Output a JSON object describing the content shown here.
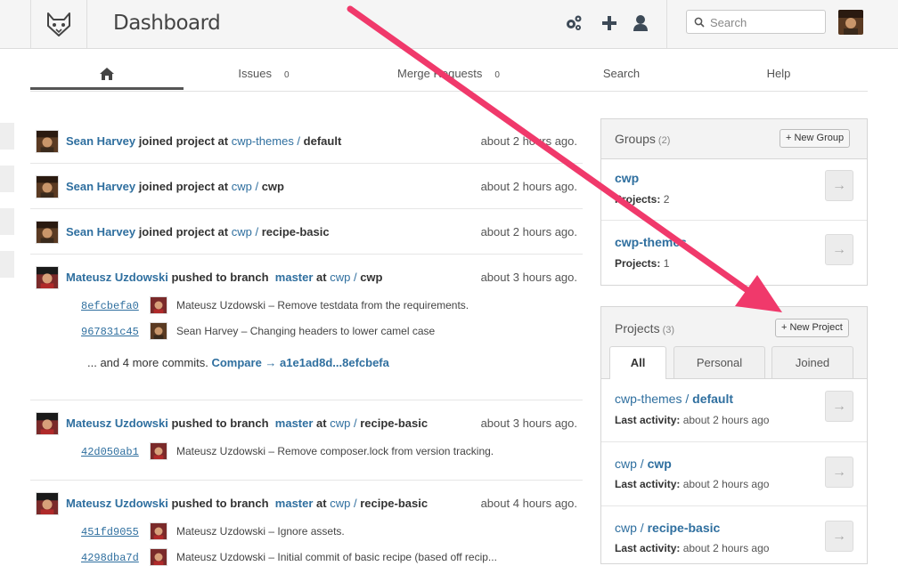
{
  "header": {
    "title": "Dashboard",
    "search_placeholder": "Search",
    "icons": [
      "gitlab-fox-logo",
      "settings-gears-icon",
      "plus-icon",
      "user-icon",
      "search-icon"
    ]
  },
  "nav": {
    "home_icon": "home-icon",
    "issues_label": "Issues",
    "issues_count": "0",
    "mr_label": "Merge Requests",
    "mr_count": "0",
    "search_label": "Search",
    "help_label": "Help"
  },
  "events": [
    {
      "author": "Sean Harvey",
      "action": "joined project",
      "at": "at",
      "namespace": "cwp-themes /",
      "project": "default",
      "time": "about 2 hours ago."
    },
    {
      "author": "Sean Harvey",
      "action": "joined project",
      "at": "at",
      "namespace": "cwp /",
      "project": "cwp",
      "time": "about 2 hours ago."
    },
    {
      "author": "Sean Harvey",
      "action": "joined project",
      "at": "at",
      "namespace": "cwp /",
      "project": "recipe-basic",
      "time": "about 2 hours ago."
    },
    {
      "author": "Mateusz Uzdowski",
      "action": "pushed to branch",
      "branch": "master",
      "at": "at",
      "namespace": "cwp /",
      "project": "cwp",
      "time": "about 3 hours ago.",
      "commits": [
        {
          "sha": "8efcbefa0",
          "message": "Mateusz Uzdowski – Remove testdata from the requirements."
        },
        {
          "sha": "967831c45",
          "message": "Sean Harvey – Changing headers to lower camel case"
        }
      ],
      "more_text": "... and 4 more commits.",
      "compare_text": "Compare → a1e1ad8d...8efcbefa"
    },
    {
      "author": "Mateusz Uzdowski",
      "action": "pushed to branch",
      "branch": "master",
      "at": "at",
      "namespace": "cwp /",
      "project": "recipe-basic",
      "time": "about 3 hours ago.",
      "commits": [
        {
          "sha": "42d050ab1",
          "message": "Mateusz Uzdowski – Remove composer.lock from version tracking."
        }
      ]
    },
    {
      "author": "Mateusz Uzdowski",
      "action": "pushed to branch",
      "branch": "master",
      "at": "at",
      "namespace": "cwp /",
      "project": "recipe-basic",
      "time": "about 4 hours ago.",
      "commits": [
        {
          "sha": "451fd9055",
          "message": "Mateusz Uzdowski – Ignore assets."
        },
        {
          "sha": "4298dba7d",
          "message": "Mateusz Uzdowski – Initial commit of basic recipe (based off recip..."
        }
      ]
    }
  ],
  "groups": {
    "title": "Groups",
    "count": "(2)",
    "new_button": "+ New Group",
    "items": [
      {
        "name": "cwp",
        "meta_label": "Projects:",
        "meta_value": "2"
      },
      {
        "name": "cwp-themes",
        "meta_label": "Projects:",
        "meta_value": "1"
      }
    ]
  },
  "projects": {
    "title": "Projects",
    "count": "(3)",
    "new_button": "+ New Project",
    "tabs": [
      "All",
      "Personal",
      "Joined"
    ],
    "active_tab": "All",
    "items": [
      {
        "namespace": "cwp-themes /",
        "name": "default",
        "meta_label": "Last activity:",
        "meta_value": "about 2 hours ago"
      },
      {
        "namespace": "cwp /",
        "name": "cwp",
        "meta_label": "Last activity:",
        "meta_value": "about 2 hours ago"
      },
      {
        "namespace": "cwp /",
        "name": "recipe-basic",
        "meta_label": "Last activity:",
        "meta_value": "about 2 hours ago"
      }
    ]
  },
  "arrow_icon": "→",
  "colors": {
    "link": "#2f6f9f",
    "annotation_arrow": "#f0396b"
  }
}
